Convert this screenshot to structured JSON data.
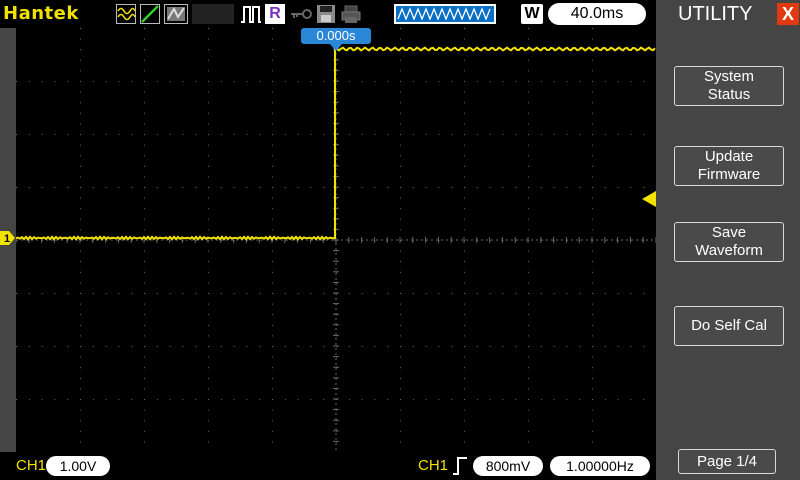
{
  "brand": "Hantek",
  "topbar": {
    "icons": [
      "acquire-normal-icon",
      "ramp-icon",
      "gray-wave-icon",
      "trigger-pulse-icon",
      "record-icon",
      "key-icon",
      "save-disk-icon",
      "print-icon",
      "memory-waveform-icon"
    ],
    "record_letter": "R",
    "timebase_mode": "W",
    "timebase_value": "40.0ms"
  },
  "screen": {
    "trigger_time": "0.000s",
    "trace_color": "#f2e200",
    "ch1_marker": "1"
  },
  "bottom": {
    "ch1_label": "CH1",
    "ch1_scale": "1.00V",
    "trig_source": "CH1",
    "trig_level": "800mV",
    "trig_frequency": "1.00000Hz"
  },
  "side_menu": {
    "title": "UTILITY",
    "close_label": "X",
    "buttons": [
      "System\nStatus",
      "Update\nFirmware",
      "Save\nWaveform",
      "Do Self Cal"
    ],
    "page": "Page 1/4"
  }
}
